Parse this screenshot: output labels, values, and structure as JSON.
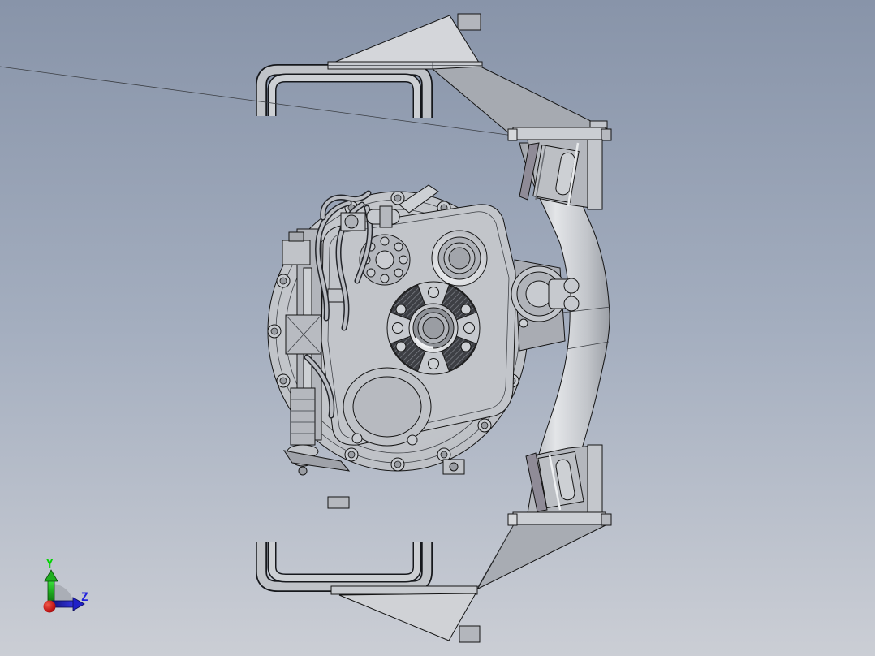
{
  "viewport": {
    "description": "3D CAD shaded view of a gearbox with tubular mounting frame",
    "colors": {
      "bg_top": "#8894a9",
      "bg_mid": "#a4aebf",
      "bg_bottom": "#cbced5",
      "edge": "#141414",
      "face_light": "#d3d5d9",
      "face_mid": "#bcbfc4",
      "face_dark": "#a0a4ab",
      "face_shadow": "#8f8b97",
      "tube_highlight": "#e3e5e8"
    }
  },
  "triad": {
    "label_y": "Y",
    "label_z": "Z",
    "color_y_label": "#00d400",
    "color_z_label": "#2222dd",
    "color_y_axis": "#1fae1f",
    "color_z_axis": "#2020c8",
    "color_origin": "#c01414"
  }
}
